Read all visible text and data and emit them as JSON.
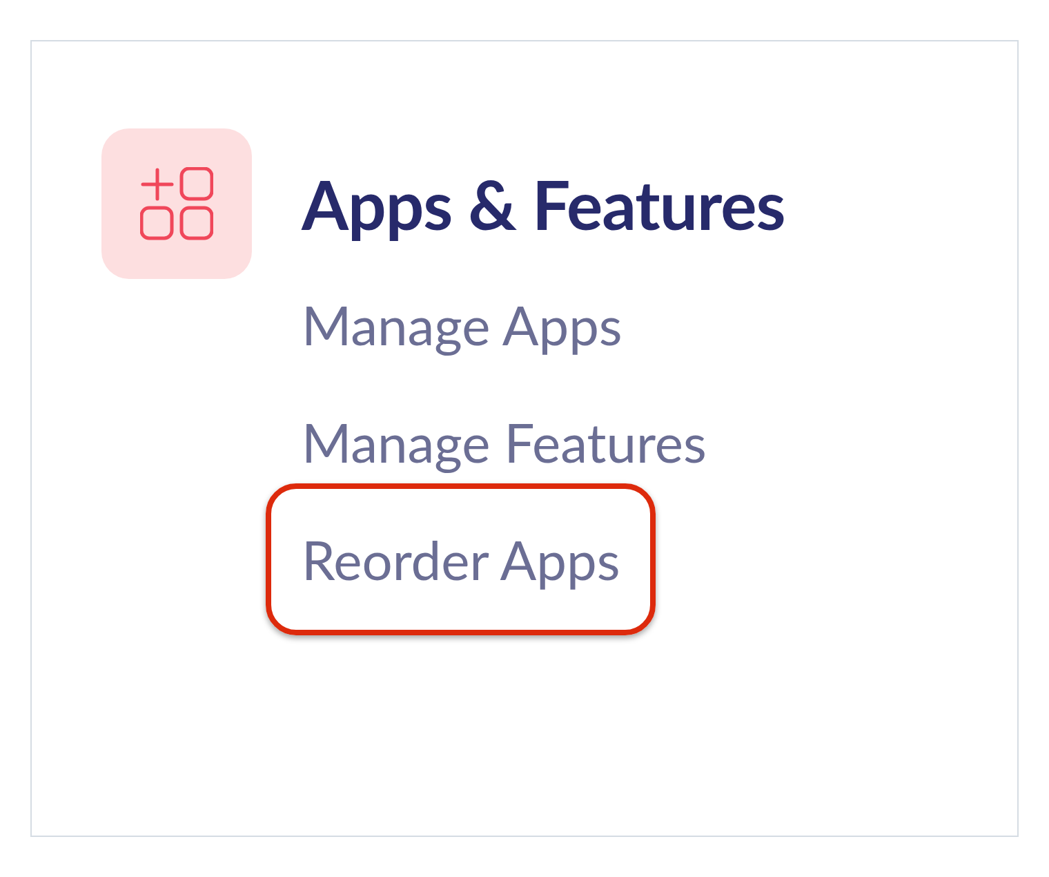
{
  "section": {
    "title": "Apps & Features",
    "links": [
      {
        "label": "Manage Apps",
        "highlighted": false
      },
      {
        "label": "Manage Features",
        "highlighted": false
      },
      {
        "label": "Reorder Apps",
        "highlighted": true
      }
    ]
  }
}
